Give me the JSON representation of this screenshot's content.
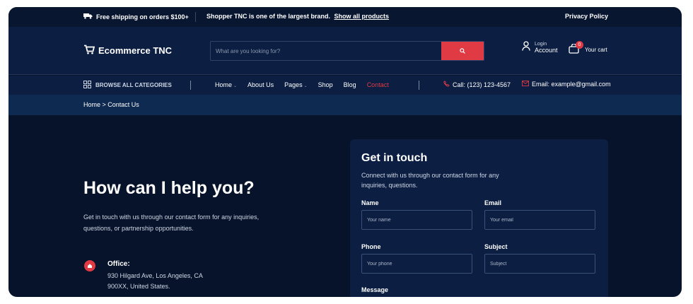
{
  "topbar": {
    "shipping": "Free shipping on orders $100+",
    "promo": "Shopper TNC is one of the largest brand.",
    "promo_link": "Show all products",
    "privacy": "Privacy Policy"
  },
  "header": {
    "logo": "Ecommerce TNC",
    "search_placeholder": "What are you looking for?",
    "login_small": "Login",
    "account": "Account",
    "cart_count": "0",
    "cart_label": "Your cart"
  },
  "nav": {
    "categories": "BROWSE ALL CATEGORIES",
    "items": [
      {
        "label": "Home",
        "caret": "⌄"
      },
      {
        "label": "About Us"
      },
      {
        "label": "Pages",
        "caret": "⌄"
      },
      {
        "label": "Shop"
      },
      {
        "label": "Blog"
      },
      {
        "label": "Contact"
      }
    ],
    "call": "Call: (123) 123-4567",
    "email": "Email: example@gmail.com"
  },
  "breadcrumb": "Home > Contact Us",
  "hero": {
    "title": "How can I help you?",
    "subtitle": "Get in touch with us through our contact form for any inquiries, questions, or partnership opportunities.",
    "office_label": "Office:",
    "office_line1": "930 Hilgard Ave, Los Angeles, CA",
    "office_line2": "900XX, United States."
  },
  "form": {
    "title": "Get in touch",
    "description": "Connect with us through our contact form for any inquiries, questions.",
    "name_label": "Name",
    "name_placeholder": "Your name",
    "email_label": "Email",
    "email_placeholder": "Your email",
    "phone_label": "Phone",
    "phone_placeholder": "Your phone",
    "subject_label": "Subject",
    "subject_placeholder": "Subject",
    "message_label": "Message"
  },
  "colors": {
    "background": "#07132a",
    "header": "#0c1f42",
    "breadcrumb_bar": "#0f2a50",
    "accent": "#e03a45"
  }
}
